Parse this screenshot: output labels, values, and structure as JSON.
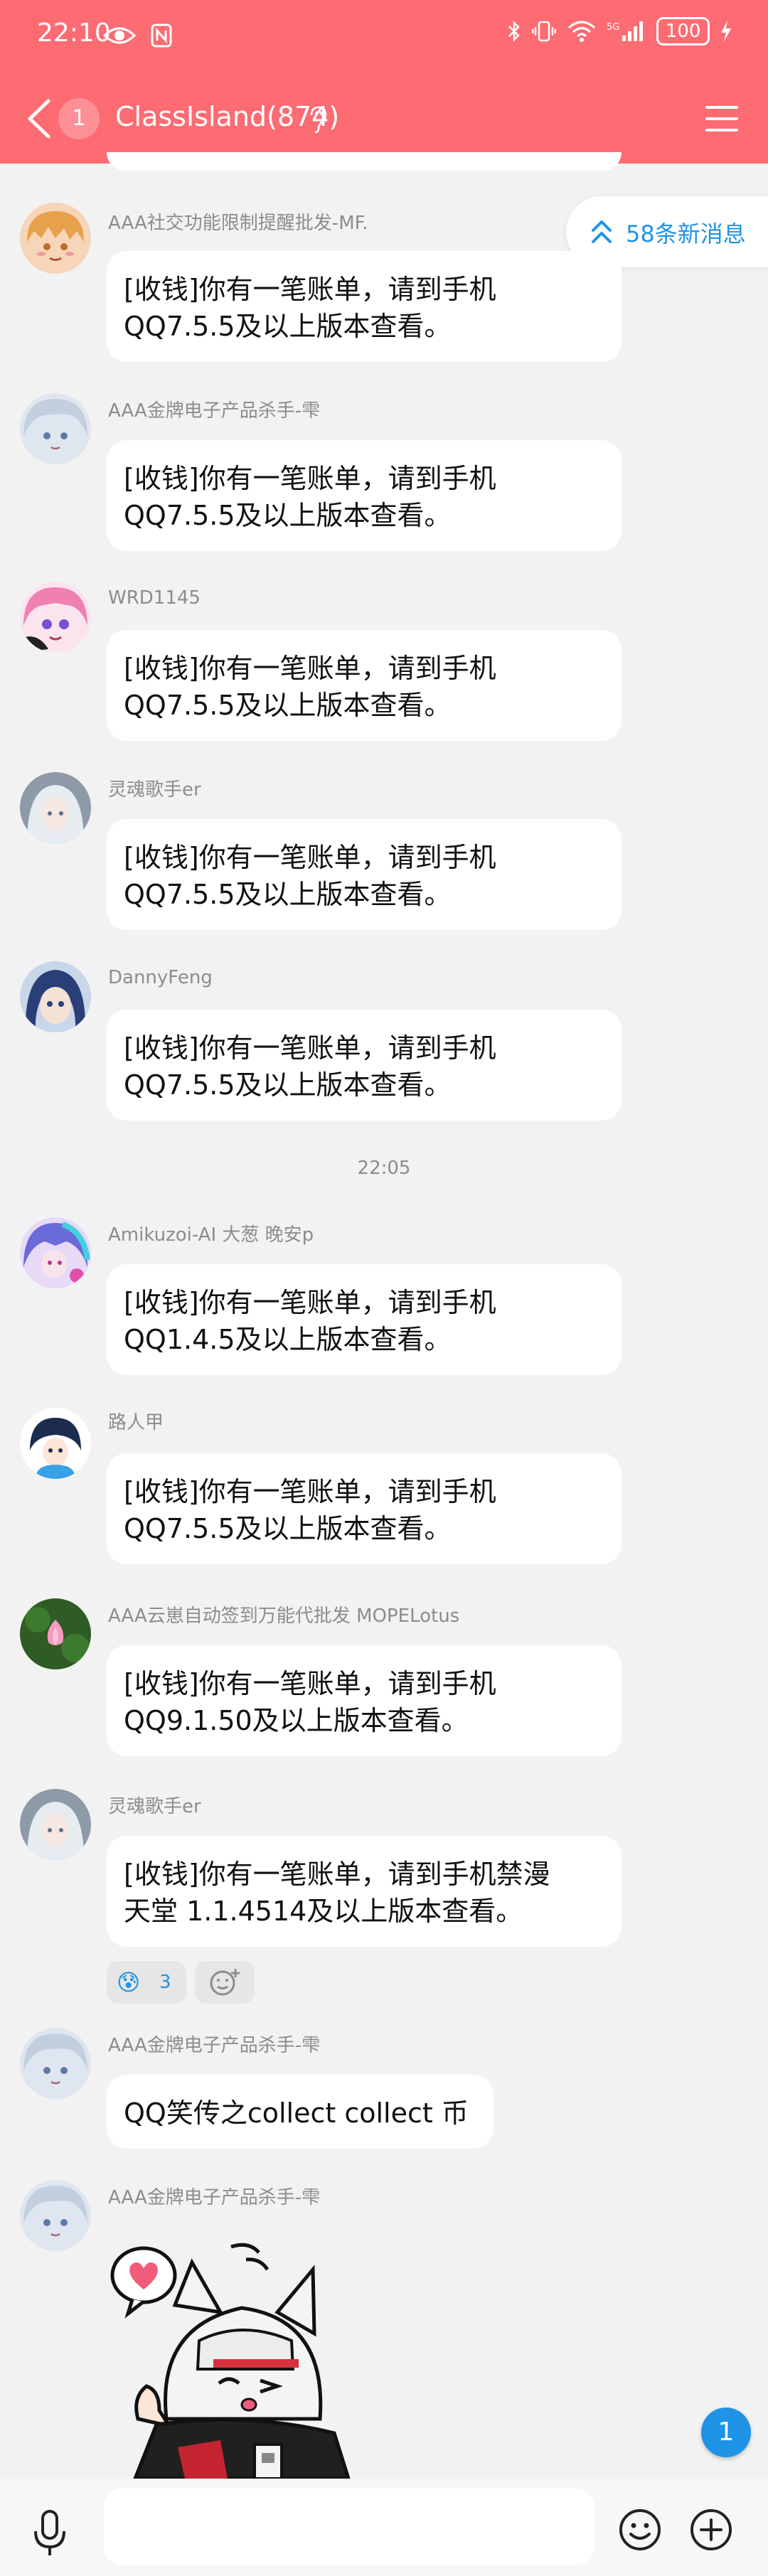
{
  "status_bar": {
    "time": "22:10",
    "left_icons": [
      "eye-icon",
      "nfc-icon"
    ],
    "right_icons": [
      "bluetooth-icon",
      "vibrate-icon",
      "wifi-icon",
      "5g-signal-icon",
      "charging-icon"
    ],
    "battery": "100"
  },
  "header": {
    "unread": "1",
    "title": "ClassIsland(874)",
    "bg_color": "#fd6b73"
  },
  "new_messages": {
    "label": "58条新消息",
    "color": "#1f93e5"
  },
  "messages": [
    {
      "sender": "AAA社交功能限制提醒批发-MF.",
      "lines": [
        "[收钱]你有一笔账单，请到手机",
        "QQ7.5.5及以上版本查看。"
      ]
    },
    {
      "sender": "AAA金牌电子产品杀手-雫",
      "lines": [
        "[收钱]你有一笔账单，请到手机",
        "QQ7.5.5及以上版本查看。"
      ]
    },
    {
      "sender": "WRD1145",
      "lines": [
        "[收钱]你有一笔账单，请到手机",
        "QQ7.5.5及以上版本查看。"
      ]
    },
    {
      "sender": "灵魂歌手er",
      "lines": [
        "[收钱]你有一笔账单，请到手机",
        "QQ7.5.5及以上版本查看。"
      ]
    },
    {
      "sender": "DannyFeng",
      "lines": [
        "[收钱]你有一笔账单，请到手机",
        "QQ7.5.5及以上版本查看。"
      ]
    },
    {
      "sender": "Amikuzoi-AI 大葱 晚安p",
      "lines": [
        "[收钱]你有一笔账单，请到手机",
        "QQ1.4.5及以上版本查看。"
      ]
    },
    {
      "sender": "路人甲",
      "lines": [
        "[收钱]你有一笔账单，请到手机",
        "QQ7.5.5及以上版本查看。"
      ]
    },
    {
      "sender": "AAA云崽自动签到万能代批发 MOPELotus",
      "lines": [
        "[收钱]你有一笔账单，请到手机",
        "QQ9.1.50及以上版本查看。"
      ]
    },
    {
      "sender": "灵魂歌手er",
      "lines": [
        "[收钱]你有一笔账单，请到手机禁漫",
        "天堂 1.1.4514及以上版本查看。"
      ]
    },
    {
      "sender": "AAA金牌电子产品杀手-雫",
      "lines": [
        "QQ笑传之collect collect 币"
      ]
    },
    {
      "sender": "AAA金牌电子产品杀手-雫",
      "sticker": "anime-girl-sticker"
    }
  ],
  "time_divider": "22:05",
  "reaction": {
    "emoji": "😰",
    "count": "3"
  },
  "input": {
    "placeholder": ""
  },
  "floating_badge": "1"
}
